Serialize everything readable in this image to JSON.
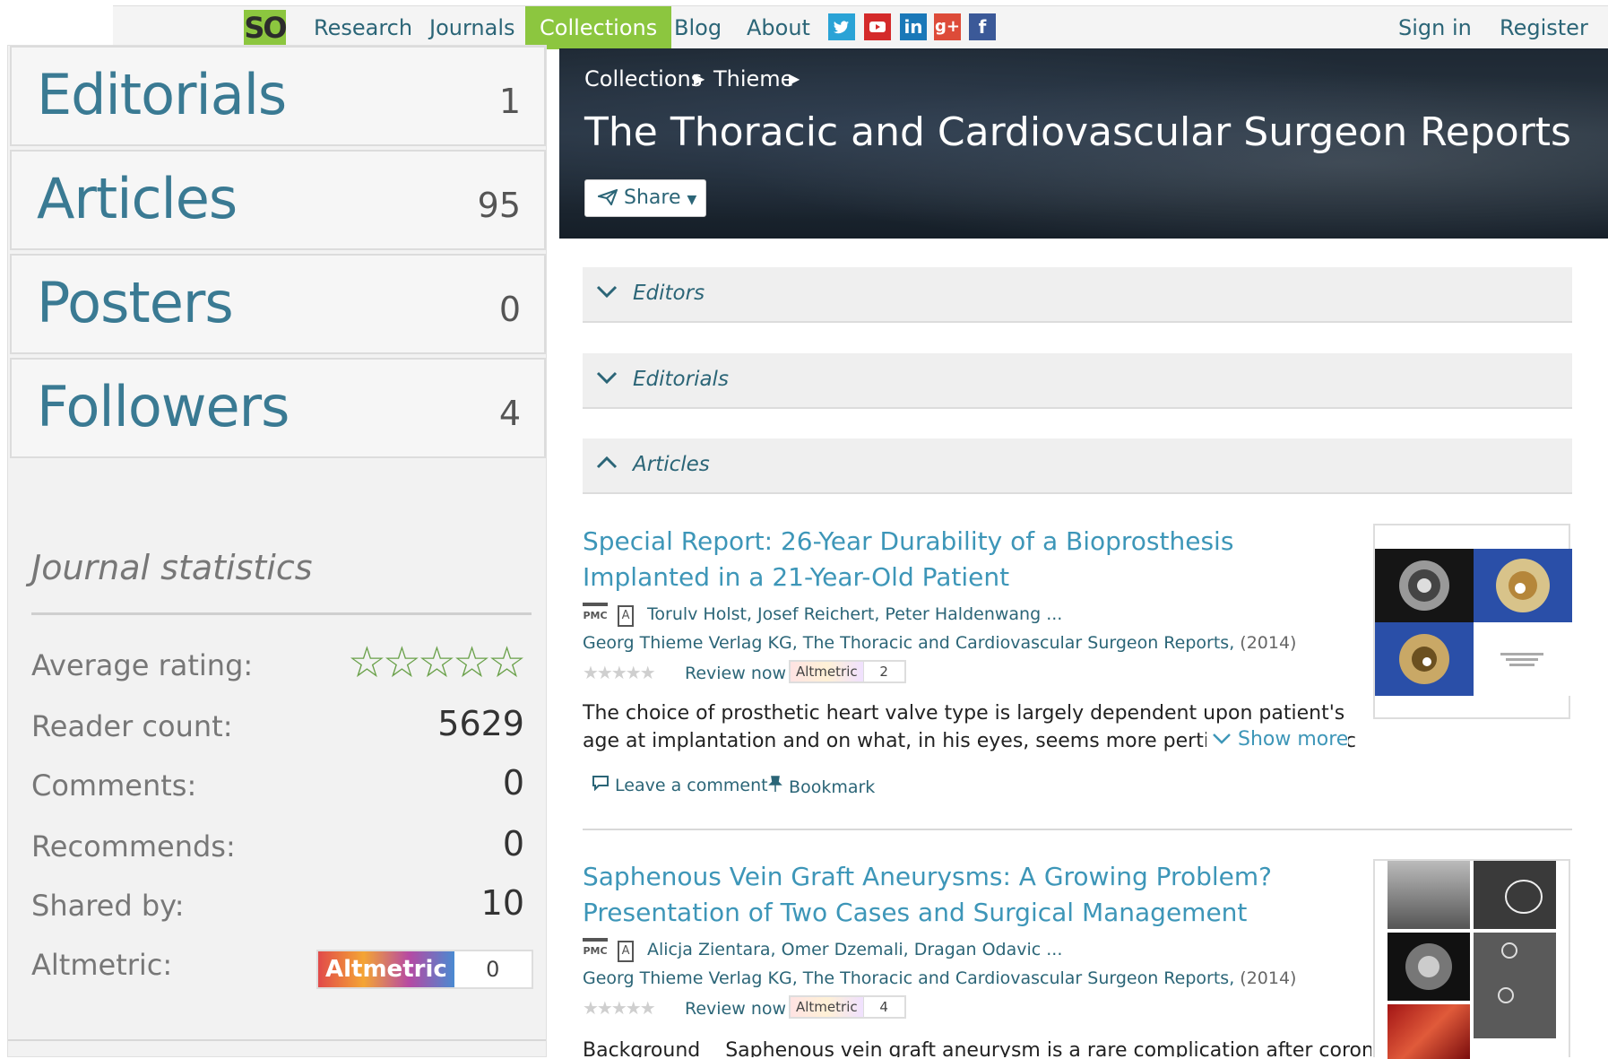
{
  "nav": {
    "logo": "SO",
    "links": [
      "Research",
      "Journals",
      "Collections",
      "Blog",
      "About"
    ],
    "social": [
      "twitter-icon",
      "youtube-icon",
      "linkedin-icon",
      "googleplus-icon",
      "facebook-icon"
    ],
    "sign_in": "Sign in",
    "register": "Register"
  },
  "sidebar": {
    "counts": [
      {
        "label": "Editorials",
        "value": "1"
      },
      {
        "label": "Articles",
        "value": "95"
      },
      {
        "label": "Posters",
        "value": "0"
      },
      {
        "label": "Followers",
        "value": "4"
      }
    ],
    "stats_title": "Journal statistics",
    "average_rating_label": "Average rating:",
    "average_rating_stars": 0,
    "reader_count_label": "Reader count:",
    "reader_count": "5629",
    "comments_label": "Comments:",
    "comments": "0",
    "recommends_label": "Recommends:",
    "recommends": "0",
    "shared_by_label": "Shared by:",
    "shared_by": "10",
    "altmetric_label": "Altmetric:",
    "altmetric_name": "Altmetric",
    "altmetric_value": "0"
  },
  "hero": {
    "breadcrumb": [
      "Collections",
      "Thieme"
    ],
    "title": "The Thoracic and Cardiovascular Surgeon Reports",
    "share_label": "Share"
  },
  "sections": [
    {
      "label": "Editors",
      "expanded": false
    },
    {
      "label": "Editorials",
      "expanded": false
    },
    {
      "label": "Articles",
      "expanded": true
    }
  ],
  "articles": [
    {
      "title": "Special Report: 26-Year Durability of a Bioprosthesis Implanted in a 21-Year-Old Patient",
      "icons": [
        "PMC",
        "A"
      ],
      "authors": "Torulv Holst, Josef Reichert, Peter Haldenwang ...",
      "publisher": "Georg Thieme Verlag KG, The Thoracic and Cardiovascular Surgeon Reports,",
      "year": "(2014)",
      "review_label": "Review now",
      "altmetric_name": "Altmetric",
      "altmetric": "2",
      "abstract": "The choice of prosthetic heart valve type is largely dependent upon patient's age at implantation and on what, in his eyes, seems more pertinent: avoidanc",
      "show_more": "Show more",
      "comment_label": "Leave a comment",
      "bookmark_label": "Bookmark"
    },
    {
      "title": "Saphenous Vein Graft Aneurysms: A Growing Problem? Presentation of Two Cases and Surgical Management",
      "icons": [
        "PMC",
        "A"
      ],
      "authors": "Alicja Zientara, Omer Dzemali, Dragan Odavic ...",
      "publisher": "Georg Thieme Verlag KG, The Thoracic and Cardiovascular Surgeon Reports,",
      "year": "(2014)",
      "review_label": "Review now",
      "altmetric_name": "Altmetric",
      "altmetric": "4",
      "abstract": "Background    Saphenous vein graft aneurysm is a rare complication after coronary"
    }
  ]
}
